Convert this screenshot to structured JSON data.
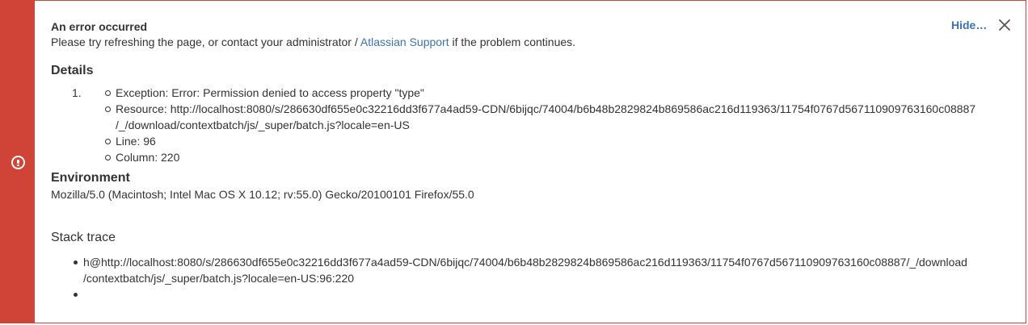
{
  "error": {
    "title": "An error occurred",
    "message_prefix": "Please try refreshing the page, or contact your administrator / ",
    "support_link": "Atlassian Support",
    "message_suffix": " if the problem continues.",
    "hide_label": "Hide…",
    "close_icon": "close-icon",
    "alert_icon": "exclamation-circle-icon",
    "accent_color": "#d04437",
    "link_color": "#3b73af"
  },
  "details": {
    "heading": "Details",
    "item_number": "1.",
    "items": [
      "Exception: Error: Permission denied to access property \"type\"",
      "Resource: http://localhost:8080/s/286630df655e0c32216dd3f677a4ad59-CDN/6bijqc/74004/b6b48b2829824b869586ac216d119363/11754f0767d567110909763160c08887",
      "/_/download/contextbatch/js/_super/batch.js?locale=en-US",
      "Line: 96",
      "Column: 220"
    ]
  },
  "environment": {
    "heading": "Environment",
    "user_agent": "Mozilla/5.0 (Macintosh; Intel Mac OS X 10.12; rv:55.0) Gecko/20100101 Firefox/55.0"
  },
  "stack": {
    "heading": "Stack trace",
    "entries": [
      "h@http://localhost:8080/s/286630df655e0c32216dd3f677a4ad59-CDN/6bijqc/74004/b6b48b2829824b869586ac216d119363/11754f0767d567110909763160c08887/_/download",
      "/contextbatch/js/_super/batch.js?locale=en-US:96:220",
      ""
    ]
  }
}
